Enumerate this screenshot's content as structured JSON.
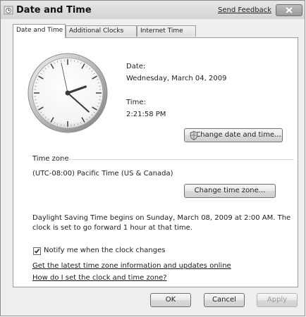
{
  "window": {
    "title": "Date and Time",
    "feedback_link": "Send Feedback"
  },
  "tabs": [
    {
      "label": "Date and Time",
      "active": true
    },
    {
      "label": "Additional Clocks",
      "active": false
    },
    {
      "label": "Internet Time",
      "active": false
    }
  ],
  "date_section": {
    "date_label": "Date:",
    "date_value": "Wednesday, March 04, 2009",
    "time_label": "Time:",
    "time_value": "2:21:58 PM",
    "change_datetime_button": "Change date and time..."
  },
  "clock": {
    "hour": 2,
    "minute": 21,
    "second": 58
  },
  "timezone": {
    "heading": "Time zone",
    "value": "(UTC-08:00) Pacific Time (US & Canada)",
    "change_button": "Change time zone..."
  },
  "dst": {
    "line1": "Daylight Saving Time begins on Sunday, March 08, 2009 at 2:00 AM. The",
    "line2": "clock is set to go forward 1 hour at that time."
  },
  "notify": {
    "label": "Notify me when the clock changes",
    "checked": true
  },
  "links": {
    "latest_info": "Get the latest time zone information and updates online",
    "how_to_set": "How do I set the clock and time zone?"
  },
  "buttons": {
    "ok": "OK",
    "cancel": "Cancel",
    "apply": "Apply"
  }
}
